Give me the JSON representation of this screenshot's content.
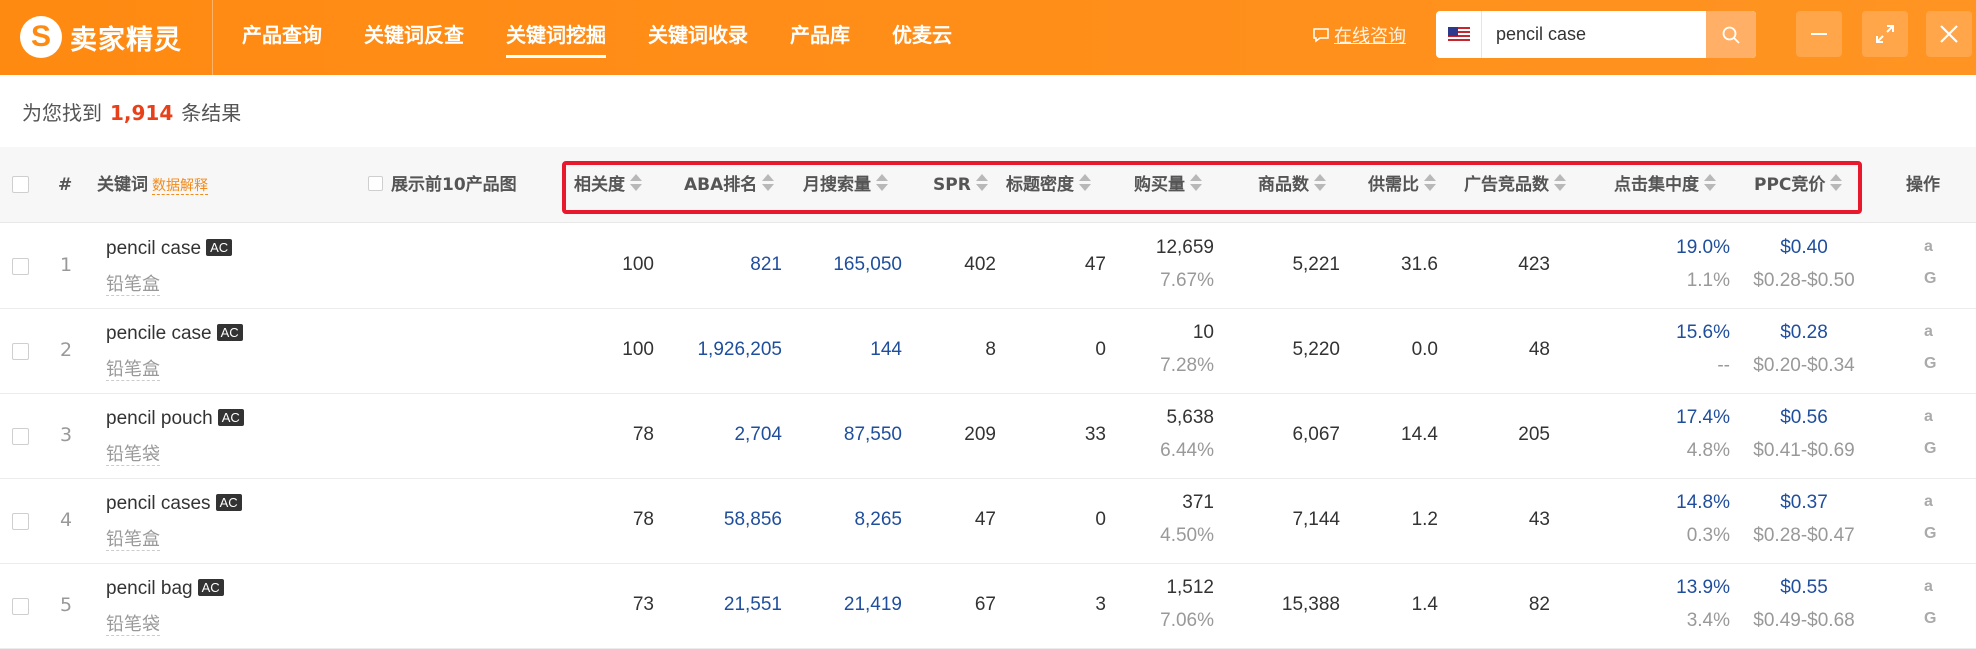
{
  "app": {
    "logo_mark": "S",
    "logo_text": "卖家精灵"
  },
  "nav": [
    {
      "label": "产品查询",
      "active": false
    },
    {
      "label": "关键词反查",
      "active": false
    },
    {
      "label": "关键词挖掘",
      "active": true
    },
    {
      "label": "关键词收录",
      "active": false
    },
    {
      "label": "产品库",
      "active": false
    },
    {
      "label": "优麦云",
      "active": false
    }
  ],
  "consult_label": "在线咨询",
  "search": {
    "value": "pencil case",
    "marketplace_flag": "us-flag-icon"
  },
  "summary": {
    "prefix": "为您找到",
    "count": "1,914",
    "suffix": "条结果"
  },
  "table": {
    "headers": {
      "index": "#",
      "keyword": "关键词",
      "explain": "数据解释",
      "show_images": "展示前10产品图",
      "relevance": "相关度",
      "aba_rank": "ABA排名",
      "monthly_search": "月搜索量",
      "spr": "SPR",
      "title_density": "标题密度",
      "purchases": "购买量",
      "products": "商品数",
      "supply_demand": "供需比",
      "ad_competitors": "广告竞品数",
      "click_concentration": "点击集中度",
      "ppc": "PPC竞价",
      "actions": "操作"
    },
    "rows": [
      {
        "index": "1",
        "keyword": "pencil case",
        "tag": "AC",
        "cn": "铅笔盒",
        "relevance": "100",
        "aba_rank": "821",
        "monthly_search": "165,050",
        "spr": "402",
        "title_density": "47",
        "purchases": "12,659",
        "purchase_rate": "7.67%",
        "products": "5,221",
        "supply_demand": "31.6",
        "ad_competitors": "423",
        "click_concentration": "19.0%",
        "click_sub": "1.1%",
        "ppc": "$0.40",
        "ppc_range": "$0.28-$0.50"
      },
      {
        "index": "2",
        "keyword": "pencile case",
        "tag": "AC",
        "cn": "铅笔盒",
        "relevance": "100",
        "aba_rank": "1,926,205",
        "monthly_search": "144",
        "spr": "8",
        "title_density": "0",
        "purchases": "10",
        "purchase_rate": "7.28%",
        "products": "5,220",
        "supply_demand": "0.0",
        "ad_competitors": "48",
        "click_concentration": "15.6%",
        "click_sub": "--",
        "ppc": "$0.28",
        "ppc_range": "$0.20-$0.34"
      },
      {
        "index": "3",
        "keyword": "pencil pouch",
        "tag": "AC",
        "cn": "铅笔袋",
        "relevance": "78",
        "aba_rank": "2,704",
        "monthly_search": "87,550",
        "spr": "209",
        "title_density": "33",
        "purchases": "5,638",
        "purchase_rate": "6.44%",
        "products": "6,067",
        "supply_demand": "14.4",
        "ad_competitors": "205",
        "click_concentration": "17.4%",
        "click_sub": "4.8%",
        "ppc": "$0.56",
        "ppc_range": "$0.41-$0.69"
      },
      {
        "index": "4",
        "keyword": "pencil cases",
        "tag": "AC",
        "cn": "铅笔盒",
        "relevance": "78",
        "aba_rank": "58,856",
        "monthly_search": "8,265",
        "spr": "47",
        "title_density": "0",
        "purchases": "371",
        "purchase_rate": "4.50%",
        "products": "7,144",
        "supply_demand": "1.2",
        "ad_competitors": "43",
        "click_concentration": "14.8%",
        "click_sub": "0.3%",
        "ppc": "$0.37",
        "ppc_range": "$0.28-$0.47"
      },
      {
        "index": "5",
        "keyword": "pencil bag",
        "tag": "AC",
        "cn": "铅笔袋",
        "relevance": "73",
        "aba_rank": "21,551",
        "monthly_search": "21,419",
        "spr": "67",
        "title_density": "3",
        "purchases": "1,512",
        "purchase_rate": "7.06%",
        "products": "15,388",
        "supply_demand": "1.4",
        "ad_competitors": "82",
        "click_concentration": "13.9%",
        "click_sub": "3.4%",
        "ppc": "$0.55",
        "ppc_range": "$0.49-$0.68"
      }
    ],
    "row_action_icons": [
      "amazon-icon",
      "google-icon"
    ]
  },
  "colors": {
    "brand_orange": "#ff8a12",
    "highlight_red": "#e8192c",
    "link_blue": "#1f4e9c",
    "count_red": "#e8401a"
  }
}
